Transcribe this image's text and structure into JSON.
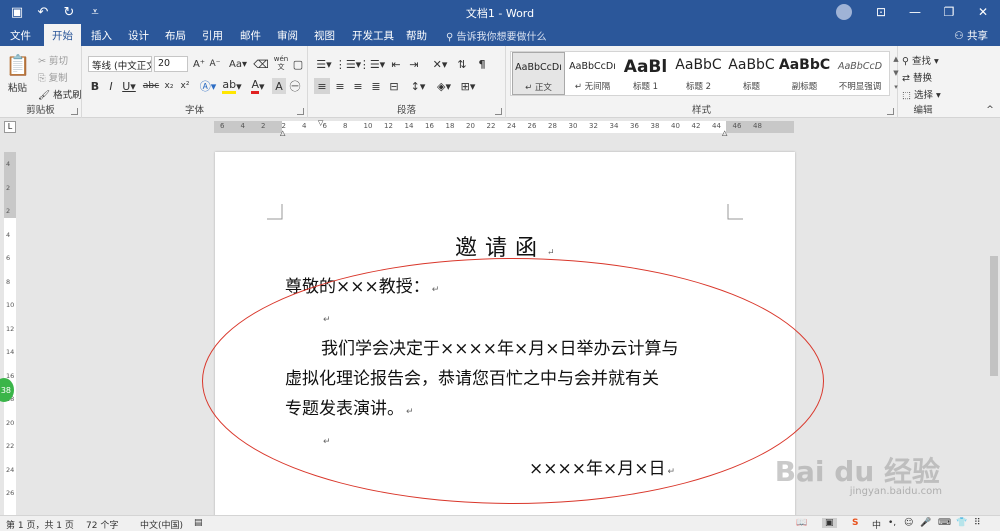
{
  "window": {
    "title": "文档1 - Word"
  },
  "tabs": [
    "文件",
    "开始",
    "插入",
    "设计",
    "布局",
    "引用",
    "邮件",
    "审阅",
    "视图",
    "开发工具",
    "帮助"
  ],
  "active_tab": "开始",
  "tell_me": "告诉我你想要做什么",
  "share": "共享",
  "clipboard": {
    "paste": "粘贴",
    "cut": "剪切",
    "copy": "复制",
    "format_painter": "格式刷",
    "label": "剪贴板"
  },
  "font": {
    "name": "等线 (中文正文)",
    "size": "20",
    "label": "字体",
    "aa": "Aa",
    "wen": "wén"
  },
  "paragraph": {
    "label": "段落"
  },
  "styles": {
    "label": "样式",
    "items": [
      {
        "preview": "AaBbCcDı",
        "name": "↵ 正文"
      },
      {
        "preview": "AaBbCcDı",
        "name": "↵ 无间隔"
      },
      {
        "preview": "AaBl",
        "name": "标题 1"
      },
      {
        "preview": "AaBbC",
        "name": "标题 2"
      },
      {
        "preview": "AaBbC",
        "name": "标题"
      },
      {
        "preview": "AaBbC",
        "name": "副标题"
      },
      {
        "preview": "AaBbCcD",
        "name": "不明显强调"
      }
    ]
  },
  "editing": {
    "find": "查找",
    "replace": "替换",
    "select": "选择",
    "label": "编辑"
  },
  "ruler": {
    "h_labels": [
      "6",
      "4",
      "2",
      "2",
      "4",
      "6",
      "8",
      "10",
      "12",
      "14",
      "16",
      "18",
      "20",
      "22",
      "24",
      "26",
      "28",
      "30",
      "32",
      "34",
      "36",
      "38",
      "40",
      "42",
      "44",
      "46",
      "48"
    ],
    "v_labels": [
      "4",
      "2",
      "2",
      "4",
      "6",
      "8",
      "10",
      "12",
      "14",
      "16",
      "18",
      "20",
      "22",
      "24",
      "26"
    ]
  },
  "document": {
    "title": "邀请函",
    "greeting": "尊敬的×××教授：",
    "body_line1": "我们学会决定于××××年×月×日举办云计算与",
    "body_line2": "虚拟化理论报告会，恭请您百忙之中与会并就有关",
    "body_line3": "专题发表演讲。",
    "date": "××××年×月×日",
    "para_mark": "↵"
  },
  "status": {
    "page": "第 1 页，共 1 页",
    "words": "72 个字",
    "lang": "中文(中国)"
  },
  "badge": "38",
  "watermark": {
    "main": "Bai du 经验",
    "url": "jingyan.baidu.com"
  }
}
